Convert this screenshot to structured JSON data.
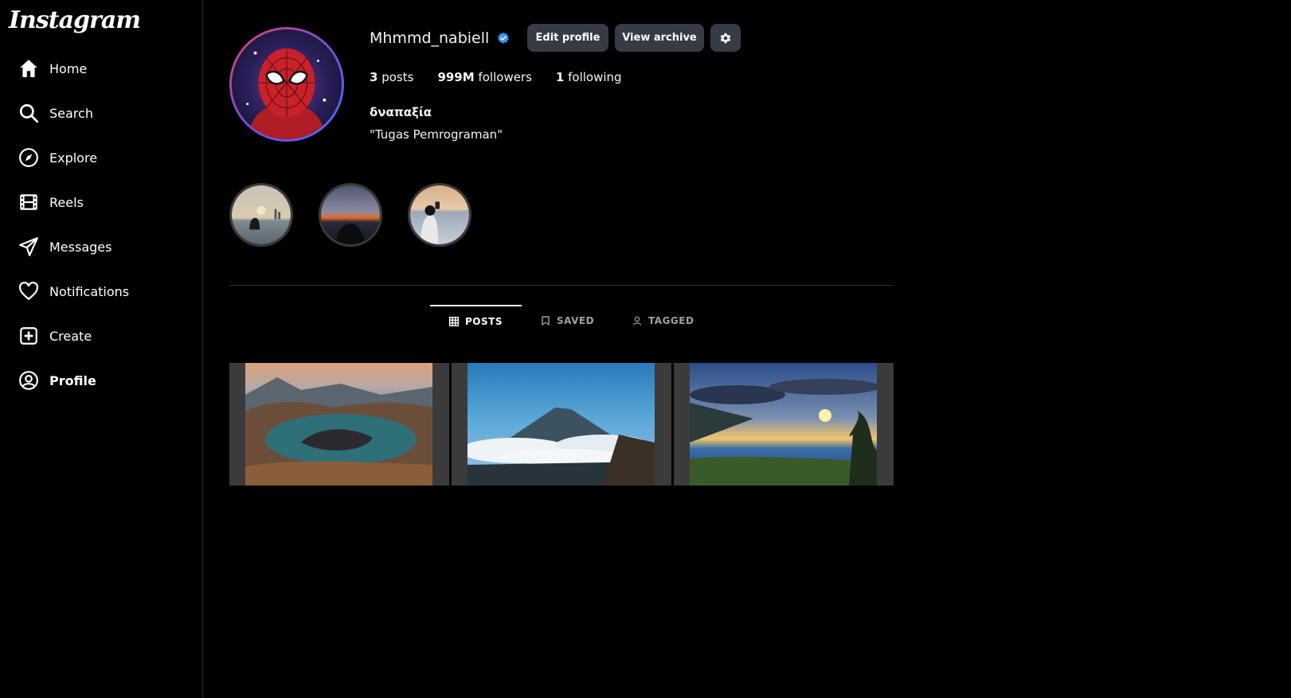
{
  "app": {
    "logo_text": "Instagram"
  },
  "sidebar": {
    "items": [
      {
        "label": "Home",
        "icon": "home-icon"
      },
      {
        "label": "Search",
        "icon": "search-icon"
      },
      {
        "label": "Explore",
        "icon": "compass-icon"
      },
      {
        "label": "Reels",
        "icon": "reels-icon"
      },
      {
        "label": "Messages",
        "icon": "send-icon"
      },
      {
        "label": "Notifications",
        "icon": "heart-icon"
      },
      {
        "label": "Create",
        "icon": "plus-square-icon"
      },
      {
        "label": "Profile",
        "icon": "user-circle-icon"
      }
    ]
  },
  "profile": {
    "username": "Mhmmd_nabiell",
    "verified": true,
    "buttons": {
      "edit": "Edit profile",
      "archive": "View archive"
    },
    "stats": {
      "posts_count": "3",
      "posts_label": "posts",
      "followers_count": "999M",
      "followers_label": "followers",
      "following_count": "1",
      "following_label": "following"
    },
    "full_name": "δναπαξία",
    "bio": "\"Tugas Pemrograman\""
  },
  "highlights": [
    {
      "icon": "highlight-sunset-girl"
    },
    {
      "icon": "highlight-dusk-silhouette"
    },
    {
      "icon": "highlight-beach-photo"
    }
  ],
  "tabs": [
    {
      "label": "POSTS",
      "icon": "grid-icon",
      "active": true
    },
    {
      "label": "SAVED",
      "icon": "bookmark-icon",
      "active": false
    },
    {
      "label": "TAGGED",
      "icon": "person-icon",
      "active": false
    }
  ],
  "colors": {
    "background": "#000000",
    "button": "#363c45",
    "verified": "#3897f0",
    "muted": "#a0a0a0"
  }
}
